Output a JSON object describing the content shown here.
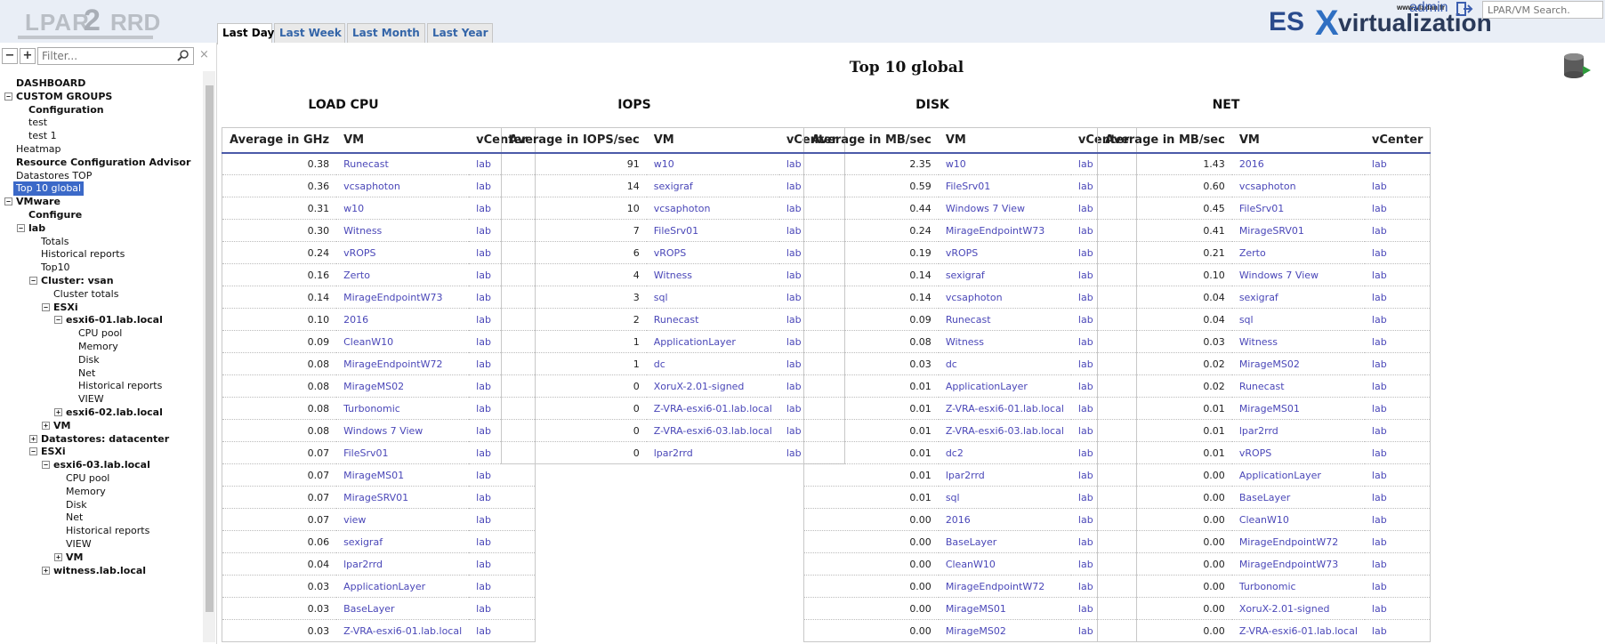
{
  "app": {
    "logo_left": "LPAR",
    "logo_num": "2",
    "logo_right": "RRD"
  },
  "tabs": [
    {
      "label": "Last Day"
    },
    {
      "label": "Last Week"
    },
    {
      "label": "Last Month"
    },
    {
      "label": "Last Year"
    }
  ],
  "brand": {
    "es": "ES",
    "x": "X",
    "virt": "virtualization",
    "url": "www.vladan.fr"
  },
  "header": {
    "user": "admin",
    "search_placeholder": "LPAR/VM Search."
  },
  "sidebar": {
    "filter_placeholder": "Filter...",
    "collapse": "−",
    "expand": "+",
    "clear": "×",
    "items": [
      "DASHBOARD",
      "CUSTOM GROUPS",
      "Configuration",
      "test",
      "test 1",
      "Heatmap",
      "Resource Configuration Advisor",
      "Datastores TOP",
      "Top 10 global",
      "VMware",
      "Configure",
      "lab",
      "Totals",
      "Historical reports",
      "Top10",
      "Cluster: vsan",
      "Cluster totals",
      "ESXi",
      "esxi6-01.lab.local",
      "CPU pool",
      "Memory",
      "Disk",
      "Net",
      "Historical reports",
      "VIEW",
      "esxi6-02.lab.local",
      "VM",
      "Datastores: datacenter",
      "ESXi",
      "esxi6-03.lab.local",
      "CPU pool",
      "Memory",
      "Disk",
      "Net",
      "Historical reports",
      "VIEW",
      "VM",
      "witness.lab.local"
    ]
  },
  "main": {
    "title": "Top 10 global",
    "sections": [
      {
        "name": "LOAD CPU",
        "headers": [
          "Average in GHz",
          "VM",
          "vCenter"
        ],
        "rows": [
          [
            "0.38",
            "Runecast",
            "lab"
          ],
          [
            "0.36",
            "vcsaphoton",
            "lab"
          ],
          [
            "0.31",
            "w10",
            "lab"
          ],
          [
            "0.30",
            "Witness",
            "lab"
          ],
          [
            "0.24",
            "vROPS",
            "lab"
          ],
          [
            "0.16",
            "Zerto",
            "lab"
          ],
          [
            "0.14",
            "MirageEndpointW73",
            "lab"
          ],
          [
            "0.10",
            "2016",
            "lab"
          ],
          [
            "0.09",
            "CleanW10",
            "lab"
          ],
          [
            "0.08",
            "MirageEndpointW72",
            "lab"
          ],
          [
            "0.08",
            "MirageMS02",
            "lab"
          ],
          [
            "0.08",
            "Turbonomic",
            "lab"
          ],
          [
            "0.08",
            "Windows 7 View",
            "lab"
          ],
          [
            "0.07",
            "FileSrv01",
            "lab"
          ],
          [
            "0.07",
            "MirageMS01",
            "lab"
          ],
          [
            "0.07",
            "MirageSRV01",
            "lab"
          ],
          [
            "0.07",
            "view",
            "lab"
          ],
          [
            "0.06",
            "sexigraf",
            "lab"
          ],
          [
            "0.04",
            "lpar2rrd",
            "lab"
          ],
          [
            "0.03",
            "ApplicationLayer",
            "lab"
          ],
          [
            "0.03",
            "BaseLayer",
            "lab"
          ],
          [
            "0.03",
            "Z-VRA-esxi6-01.lab.local",
            "lab"
          ]
        ]
      },
      {
        "name": "IOPS",
        "headers": [
          "Average in IOPS/sec",
          "VM",
          "vCenter"
        ],
        "rows": [
          [
            "91",
            "w10",
            "lab"
          ],
          [
            "14",
            "sexigraf",
            "lab"
          ],
          [
            "10",
            "vcsaphoton",
            "lab"
          ],
          [
            "7",
            "FileSrv01",
            "lab"
          ],
          [
            "6",
            "vROPS",
            "lab"
          ],
          [
            "4",
            "Witness",
            "lab"
          ],
          [
            "3",
            "sql",
            "lab"
          ],
          [
            "2",
            "Runecast",
            "lab"
          ],
          [
            "1",
            "ApplicationLayer",
            "lab"
          ],
          [
            "1",
            "dc",
            "lab"
          ],
          [
            "0",
            "XoruX-2.01-signed",
            "lab"
          ],
          [
            "0",
            "Z-VRA-esxi6-01.lab.local",
            "lab"
          ],
          [
            "0",
            "Z-VRA-esxi6-03.lab.local",
            "lab"
          ],
          [
            "0",
            "lpar2rrd",
            "lab"
          ]
        ]
      },
      {
        "name": "DISK",
        "headers": [
          "Average in MB/sec",
          "VM",
          "vCenter"
        ],
        "rows": [
          [
            "2.35",
            "w10",
            "lab"
          ],
          [
            "0.59",
            "FileSrv01",
            "lab"
          ],
          [
            "0.44",
            "Windows 7 View",
            "lab"
          ],
          [
            "0.24",
            "MirageEndpointW73",
            "lab"
          ],
          [
            "0.19",
            "vROPS",
            "lab"
          ],
          [
            "0.14",
            "sexigraf",
            "lab"
          ],
          [
            "0.14",
            "vcsaphoton",
            "lab"
          ],
          [
            "0.09",
            "Runecast",
            "lab"
          ],
          [
            "0.08",
            "Witness",
            "lab"
          ],
          [
            "0.03",
            "dc",
            "lab"
          ],
          [
            "0.01",
            "ApplicationLayer",
            "lab"
          ],
          [
            "0.01",
            "Z-VRA-esxi6-01.lab.local",
            "lab"
          ],
          [
            "0.01",
            "Z-VRA-esxi6-03.lab.local",
            "lab"
          ],
          [
            "0.01",
            "dc2",
            "lab"
          ],
          [
            "0.01",
            "lpar2rrd",
            "lab"
          ],
          [
            "0.01",
            "sql",
            "lab"
          ],
          [
            "0.00",
            "2016",
            "lab"
          ],
          [
            "0.00",
            "BaseLayer",
            "lab"
          ],
          [
            "0.00",
            "CleanW10",
            "lab"
          ],
          [
            "0.00",
            "MirageEndpointW72",
            "lab"
          ],
          [
            "0.00",
            "MirageMS01",
            "lab"
          ],
          [
            "0.00",
            "MirageMS02",
            "lab"
          ]
        ]
      },
      {
        "name": "NET",
        "headers": [
          "Average in MB/sec",
          "VM",
          "vCenter"
        ],
        "rows": [
          [
            "1.43",
            "2016",
            "lab"
          ],
          [
            "0.60",
            "vcsaphoton",
            "lab"
          ],
          [
            "0.45",
            "FileSrv01",
            "lab"
          ],
          [
            "0.41",
            "MirageSRV01",
            "lab"
          ],
          [
            "0.21",
            "Zerto",
            "lab"
          ],
          [
            "0.10",
            "Windows 7 View",
            "lab"
          ],
          [
            "0.04",
            "sexigraf",
            "lab"
          ],
          [
            "0.04",
            "sql",
            "lab"
          ],
          [
            "0.03",
            "Witness",
            "lab"
          ],
          [
            "0.02",
            "MirageMS02",
            "lab"
          ],
          [
            "0.02",
            "Runecast",
            "lab"
          ],
          [
            "0.01",
            "MirageMS01",
            "lab"
          ],
          [
            "0.01",
            "lpar2rrd",
            "lab"
          ],
          [
            "0.01",
            "vROPS",
            "lab"
          ],
          [
            "0.00",
            "ApplicationLayer",
            "lab"
          ],
          [
            "0.00",
            "BaseLayer",
            "lab"
          ],
          [
            "0.00",
            "CleanW10",
            "lab"
          ],
          [
            "0.00",
            "MirageEndpointW72",
            "lab"
          ],
          [
            "0.00",
            "MirageEndpointW73",
            "lab"
          ],
          [
            "0.00",
            "Turbonomic",
            "lab"
          ],
          [
            "0.00",
            "XoruX-2.01-signed",
            "lab"
          ],
          [
            "0.00",
            "Z-VRA-esxi6-01.lab.local",
            "lab"
          ]
        ]
      }
    ]
  }
}
